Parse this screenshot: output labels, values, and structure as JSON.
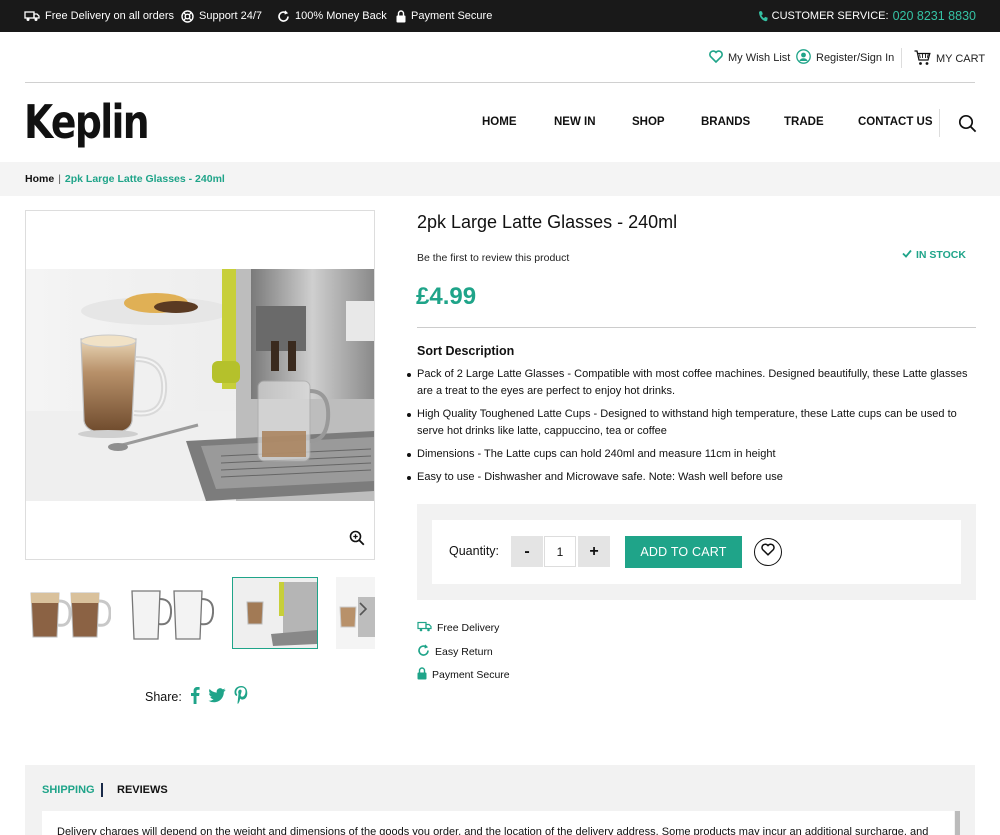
{
  "topbar": {
    "delivery": "Free Delivery on all orders",
    "support": "Support 24/7",
    "money_back": "100% Money Back",
    "payment": "Payment Secure",
    "cs_label": "CUSTOMER SERVICE:",
    "cs_phone": "020 8231 8830"
  },
  "util": {
    "wishlist": "My Wish List",
    "register": "Register/Sign In",
    "cart": "MY CART"
  },
  "logo": "Keplin",
  "nav": [
    "HOME",
    "NEW IN",
    "SHOP",
    "BRANDS",
    "TRADE",
    "CONTACT US"
  ],
  "breadcrumb": {
    "home": "Home",
    "sep": "|",
    "current": "2pk Large Latte Glasses - 240ml"
  },
  "product": {
    "title": "2pk Large Latte Glasses - 240ml",
    "review": "Be the first to review this product",
    "stock": "IN STOCK",
    "price": "£4.99",
    "desc_title": "Sort Description",
    "bullets": [
      "Pack of 2 Large Latte Glasses - Compatible with most coffee machines. Designed beautifully, these Latte glasses are a treat to the eyes are perfect to enjoy hot drinks.",
      "High Quality Toughened Latte Cups - Designed to withstand high temperature, these Latte cups can be used to serve hot drinks like latte, cappuccino, tea or coffee",
      "Dimensions - The Latte cups can hold 240ml and measure 11cm in height",
      "Easy to use - Dishwasher and Microwave safe. Note: Wash well before use"
    ],
    "quantity_label": "Quantity:",
    "quantity_value": "1",
    "minus": "-",
    "plus": "+",
    "add_to_cart": "ADD TO CART",
    "features": [
      "Free Delivery",
      "Easy Return",
      "Payment Secure"
    ],
    "share_label": "Share:"
  },
  "tabs": {
    "shipping": "SHIPPING",
    "reviews": "REVIEWS",
    "shipping_text": "Delivery charges will depend on the weight and dimensions of the goods you order, and the location of the delivery address. Some products may incur an additional surcharge, and"
  },
  "colors": {
    "accent": "#1fa489",
    "topbar_bg": "#191919"
  }
}
